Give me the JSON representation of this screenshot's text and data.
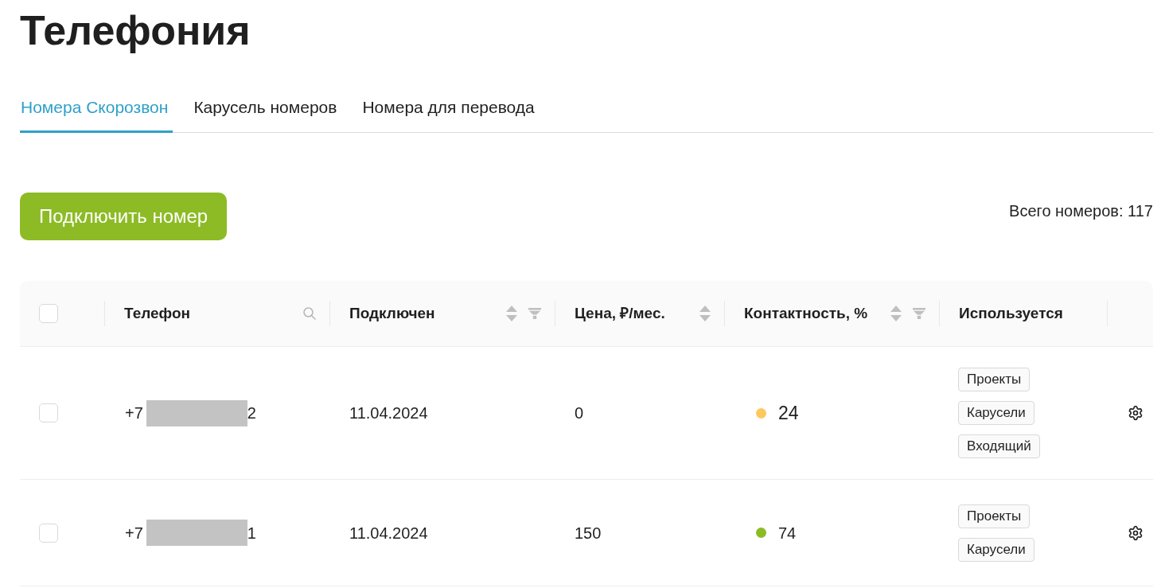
{
  "title": "Телефония",
  "tabs": [
    {
      "label": "Номера Скорозвон",
      "selected": true
    },
    {
      "label": "Карусель номеров",
      "selected": false
    },
    {
      "label": "Номера для перевода",
      "selected": false
    }
  ],
  "toolbar": {
    "connect_button": "Подключить номер",
    "total": "Всего номеров: 117"
  },
  "table": {
    "columns": [
      {
        "kind": "checkbox",
        "checked": false
      },
      {
        "kind": "text",
        "label": "Телефон",
        "search": true,
        "sortable": false,
        "filterable": false
      },
      {
        "kind": "text",
        "label": "Подключен",
        "search": false,
        "sortable": true,
        "filterable": true
      },
      {
        "kind": "text",
        "label": "Цена, ₽/мес.",
        "search": false,
        "sortable": true,
        "filterable": false
      },
      {
        "kind": "text",
        "label": "Контактность, %",
        "search": false,
        "sortable": true,
        "filterable": true
      },
      {
        "kind": "text",
        "label": "Используется",
        "search": false,
        "sortable": false,
        "filterable": false
      },
      {
        "kind": "actions"
      }
    ],
    "rows": [
      {
        "checked": false,
        "phone_start": "+7",
        "phone_end": "2",
        "connected": "11.04.2024",
        "price": "0",
        "contact": {
          "value": "24",
          "color": "#fdc95e",
          "emphasized": true
        },
        "used_in": [
          "Проекты",
          "Карусели",
          "Входящий"
        ]
      },
      {
        "checked": false,
        "phone_start": "+7",
        "phone_end": "1",
        "connected": "11.04.2024",
        "price": "150",
        "contact": {
          "value": "74",
          "color": "#8dbb25",
          "emphasized": false
        },
        "used_in": [
          "Проекты",
          "Карусели"
        ]
      }
    ]
  }
}
